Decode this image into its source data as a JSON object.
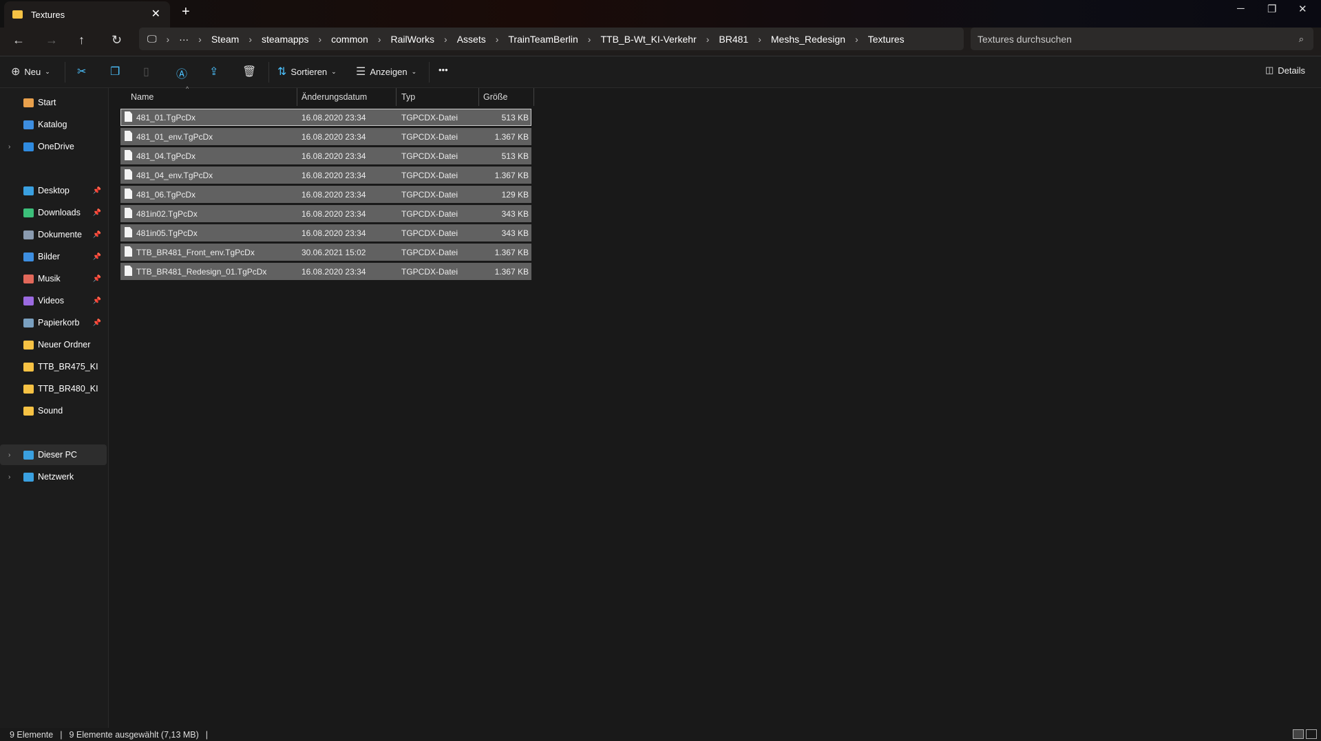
{
  "window": {
    "tab_title": "Textures"
  },
  "breadcrumb": [
    "Steam",
    "steamapps",
    "common",
    "RailWorks",
    "Assets",
    "TrainTeamBerlin",
    "TTB_B-Wt_KI-Verkehr",
    "BR481",
    "Meshs_Redesign",
    "Textures"
  ],
  "search": {
    "placeholder": "Textures durchsuchen"
  },
  "toolbar": {
    "new": "Neu",
    "sort": "Sortieren",
    "view": "Anzeigen",
    "details": "Details"
  },
  "sidebar": {
    "top": [
      {
        "label": "Start"
      },
      {
        "label": "Katalog"
      },
      {
        "label": "OneDrive"
      }
    ],
    "quick": [
      {
        "label": "Desktop"
      },
      {
        "label": "Downloads"
      },
      {
        "label": "Dokumente"
      },
      {
        "label": "Bilder"
      },
      {
        "label": "Musik"
      },
      {
        "label": "Videos"
      },
      {
        "label": "Papierkorb"
      },
      {
        "label": "Neuer Ordner"
      },
      {
        "label": "TTB_BR475_KI"
      },
      {
        "label": "TTB_BR480_KI"
      },
      {
        "label": "Sound"
      }
    ],
    "bottom": [
      {
        "label": "Dieser PC"
      },
      {
        "label": "Netzwerk"
      }
    ]
  },
  "columns": {
    "name": "Name",
    "date": "Änderungsdatum",
    "type": "Typ",
    "size": "Größe"
  },
  "files": [
    {
      "name": "481_01.TgPcDx",
      "date": "16.08.2020 23:34",
      "type": "TGPCDX-Datei",
      "size": "513 KB"
    },
    {
      "name": "481_01_env.TgPcDx",
      "date": "16.08.2020 23:34",
      "type": "TGPCDX-Datei",
      "size": "1.367 KB"
    },
    {
      "name": "481_04.TgPcDx",
      "date": "16.08.2020 23:34",
      "type": "TGPCDX-Datei",
      "size": "513 KB"
    },
    {
      "name": "481_04_env.TgPcDx",
      "date": "16.08.2020 23:34",
      "type": "TGPCDX-Datei",
      "size": "1.367 KB"
    },
    {
      "name": "481_06.TgPcDx",
      "date": "16.08.2020 23:34",
      "type": "TGPCDX-Datei",
      "size": "129 KB"
    },
    {
      "name": "481in02.TgPcDx",
      "date": "16.08.2020 23:34",
      "type": "TGPCDX-Datei",
      "size": "343 KB"
    },
    {
      "name": "481in05.TgPcDx",
      "date": "16.08.2020 23:34",
      "type": "TGPCDX-Datei",
      "size": "343 KB"
    },
    {
      "name": "TTB_BR481_Front_env.TgPcDx",
      "date": "30.06.2021 15:02",
      "type": "TGPCDX-Datei",
      "size": "1.367 KB"
    },
    {
      "name": "TTB_BR481_Redesign_01.TgPcDx",
      "date": "16.08.2020 23:34",
      "type": "TGPCDX-Datei",
      "size": "1.367 KB"
    }
  ],
  "status": {
    "count": "9 Elemente",
    "selected": "9 Elemente ausgewählt (7,13 MB)"
  }
}
